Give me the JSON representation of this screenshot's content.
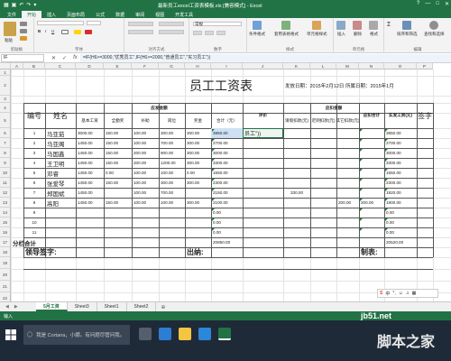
{
  "window": {
    "title": "最新员工excel工资表模板.xls [兼容模式] - Excel",
    "controls": [
      "?",
      "—",
      "□",
      "✕"
    ]
  },
  "ribbon": {
    "tabs": [
      "文件",
      "开始",
      "插入",
      "页面布局",
      "公式",
      "数据",
      "审阅",
      "视图",
      "开发工具"
    ],
    "active_tab": "开始",
    "groups": [
      "剪贴板",
      "字体",
      "对齐方式",
      "数字",
      "样式",
      "单元格",
      "编辑"
    ],
    "buttons": {
      "paste": "粘贴",
      "cond_format": "条件格式",
      "table_format": "套用表格格式",
      "cell_style": "单元格样式",
      "insert": "插入",
      "delete": "删除",
      "format": "格式",
      "sort": "排序和筛选",
      "find": "查找和选择",
      "number_format": "常规"
    }
  },
  "formula_bar": {
    "name_box": "IF",
    "formula": "=IF(H6>=3000,\"优秀员工\",IF(H6>=2000,\"普通员工\",\"实习员工\"))"
  },
  "columns": [
    "A",
    "B",
    "C",
    "D",
    "E",
    "F",
    "G",
    "H",
    "I",
    "J",
    "K",
    "L",
    "M",
    "N",
    "O",
    "P"
  ],
  "rows": [
    "1",
    "2",
    "3",
    "4",
    "5",
    "6",
    "7",
    "8",
    "9",
    "10",
    "11",
    "12",
    "13",
    "14",
    "15",
    "16",
    "17",
    "18",
    "19",
    "20",
    "21",
    "22",
    "23"
  ],
  "sheet": {
    "title": "员工工资表",
    "issue_date": "发放日期：2015年2月12日 所属日期：2015年1月",
    "headers": {
      "no": "编号",
      "name": "姓名",
      "payable": "应发金额",
      "base": "基本工资",
      "bonus": "全勤奖",
      "subsidy": "补助",
      "post": "岗位",
      "award": "奖金",
      "total": "合计（元）",
      "rating": "评价",
      "deduct": "应扣金额",
      "leave": "请假扣款(元)",
      "late": "迟到扣款(元)",
      "other": "其它扣款(元)",
      "deduct_total": "应扣合计",
      "actual": "实发工资(元)",
      "sign": "签字"
    },
    "employees": [
      {
        "no": "1",
        "name": "马亚茹",
        "base": "3000.00",
        "bonus": "150.00",
        "subsidy": "100.00",
        "post": "300.00",
        "award": "300.00",
        "total": "3850.00",
        "rating": "员工\"))",
        "leave": "",
        "late": "",
        "other": "",
        "dtotal": "",
        "actual": "3850.00"
      },
      {
        "no": "2",
        "name": "马亚阁",
        "base": "1450.00",
        "bonus": "150.00",
        "subsidy": "100.00",
        "post": "700.00",
        "award": "300.00",
        "total": "2700.00",
        "rating": "",
        "leave": "",
        "late": "",
        "other": "",
        "dtotal": "",
        "actual": "2700.00"
      },
      {
        "no": "3",
        "name": "马国鑫",
        "base": "1450.00",
        "bonus": "150.00",
        "subsidy": "200.00",
        "post": "900.00",
        "award": "300.00",
        "total": "3000.00",
        "rating": "",
        "leave": "",
        "late": "",
        "other": "",
        "dtotal": "",
        "actual": "3000.00"
      },
      {
        "no": "4",
        "name": "王卫明",
        "base": "1450.00",
        "bonus": "150.00",
        "subsidy": "200.00",
        "post": "1200.00",
        "award": "300.00",
        "total": "3300.00",
        "rating": "",
        "leave": "",
        "late": "",
        "other": "",
        "dtotal": "",
        "actual": "3300.00"
      },
      {
        "no": "5",
        "name": "邓睿",
        "base": "1450.00",
        "bonus": "0.00",
        "subsidy": "100.00",
        "post": "100.00",
        "award": "0.00",
        "total": "1650.00",
        "rating": "",
        "leave": "",
        "late": "",
        "other": "",
        "dtotal": "",
        "actual": "1650.00"
      },
      {
        "no": "6",
        "name": "张爱琴",
        "base": "1450.00",
        "bonus": "150.00",
        "subsidy": "100.00",
        "post": "300.00",
        "award": "300.00",
        "total": "2300.00",
        "rating": "",
        "leave": "",
        "late": "",
        "other": "",
        "dtotal": "",
        "actual": "2300.00"
      },
      {
        "no": "7",
        "name": "郑国斌",
        "base": "1450.00",
        "bonus": "",
        "subsidy": "100.00",
        "post": "700.00",
        "award": "",
        "total": "2150.00",
        "rating": "",
        "leave": "330.00",
        "late": "",
        "other": "",
        "dtotal": "",
        "actual": "1820.00"
      },
      {
        "no": "8",
        "name": "高阳",
        "base": "1450.00",
        "bonus": "150.00",
        "subsidy": "100.00",
        "post": "100.00",
        "award": "300.00",
        "total": "2100.00",
        "rating": "",
        "leave": "",
        "late": "",
        "other": "200.00",
        "dtotal": "200.00",
        "actual": "1900.00"
      },
      {
        "no": "9",
        "name": "",
        "base": "",
        "bonus": "",
        "subsidy": "",
        "post": "",
        "award": "",
        "total": "0.00",
        "rating": "",
        "leave": "",
        "late": "",
        "other": "",
        "dtotal": "",
        "actual": "0.00"
      },
      {
        "no": "10",
        "name": "",
        "base": "",
        "bonus": "",
        "subsidy": "",
        "post": "",
        "award": "",
        "total": "0.00",
        "rating": "",
        "leave": "",
        "late": "",
        "other": "",
        "dtotal": "",
        "actual": "0.00"
      },
      {
        "no": "11",
        "name": "",
        "base": "",
        "bonus": "",
        "subsidy": "",
        "post": "",
        "award": "",
        "total": "0.00",
        "rating": "",
        "leave": "",
        "late": "",
        "other": "",
        "dtotal": "",
        "actual": "0.00"
      }
    ],
    "subtotal_label": "分栏合计",
    "subtotal_total": "20850.00",
    "subtotal_actual": "20520.00",
    "footer": {
      "leader": "领导签字:",
      "cashier": "出纳:",
      "maker": "制表:"
    }
  },
  "sheet_tabs": [
    "5月工资",
    "Sheet3",
    "Sheet1",
    "Sheet2"
  ],
  "active_sheet": "5月工资",
  "status": "输入",
  "taskbar": {
    "search": "我是 Cortana，小娜。有问题尽管问我。",
    "time": "",
    "colors": {
      "excel": "#217346",
      "edge": "#2d7dd2",
      "explorer": "#f4c542",
      "store": "#2b88d8"
    }
  },
  "watermark": {
    "site": "jb51.net",
    "name": "脚本之家"
  }
}
